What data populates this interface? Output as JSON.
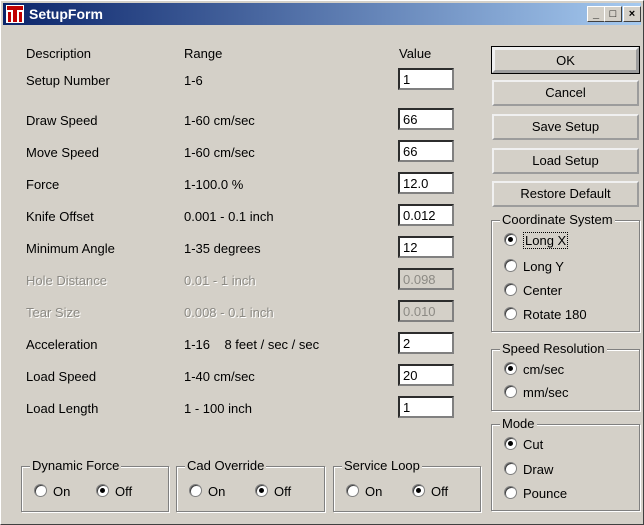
{
  "window": {
    "title": "SetupForm",
    "minimize": "_",
    "maximize": "□",
    "close": "×"
  },
  "headers": {
    "description": "Description",
    "range": "Range",
    "value": "Value"
  },
  "rows": [
    {
      "description": "Setup Number",
      "range": "1-6",
      "value": "1",
      "enabled": true
    },
    {
      "description": "Draw Speed",
      "range": "1-60 cm/sec",
      "value": "66",
      "enabled": true
    },
    {
      "description": "Move Speed",
      "range": "1-60 cm/sec",
      "value": "66",
      "enabled": true
    },
    {
      "description": "Force",
      "range": "1-100.0 %",
      "value": "12.0",
      "enabled": true
    },
    {
      "description": "Knife Offset",
      "range": "0.001 - 0.1 inch",
      "value": "0.012",
      "enabled": true
    },
    {
      "description": "Minimum Angle",
      "range": "1-35 degrees",
      "value": "12",
      "enabled": true
    },
    {
      "description": "Hole Distance",
      "range": "0.01 - 1 inch",
      "value": "0.098",
      "enabled": false
    },
    {
      "description": "Tear Size",
      "range": "0.008 - 0.1 inch",
      "value": "0.010",
      "enabled": false
    },
    {
      "description": "Acceleration",
      "range": "1-16    8 feet / sec / sec",
      "value": "2",
      "enabled": true
    },
    {
      "description": "Load Speed",
      "range": "1-40 cm/sec",
      "value": "20",
      "enabled": true
    },
    {
      "description": "Load Length",
      "range": "1 - 100 inch",
      "value": "1",
      "enabled": true
    }
  ],
  "buttons": {
    "ok": "OK",
    "cancel": "Cancel",
    "save_setup": "Save Setup",
    "load_setup": "Load Setup",
    "restore_default": "Restore Default"
  },
  "coordinate_system": {
    "title": "Coordinate System",
    "options": [
      "Long X",
      "Long Y",
      "Center",
      "Rotate 180"
    ],
    "selected": "Long X"
  },
  "speed_resolution": {
    "title": "Speed Resolution",
    "options": [
      "cm/sec",
      "mm/sec"
    ],
    "selected": "cm/sec"
  },
  "mode": {
    "title": "Mode",
    "options": [
      "Cut",
      "Draw",
      "Pounce"
    ],
    "selected": "Cut"
  },
  "dynamic_force": {
    "title": "Dynamic Force",
    "on": "On",
    "off": "Off",
    "selected": "Off"
  },
  "cad_override": {
    "title": "Cad Override",
    "on": "On",
    "off": "Off",
    "selected": "Off"
  },
  "service_loop": {
    "title": "Service Loop",
    "on": "On",
    "off": "Off",
    "selected": "Off"
  }
}
